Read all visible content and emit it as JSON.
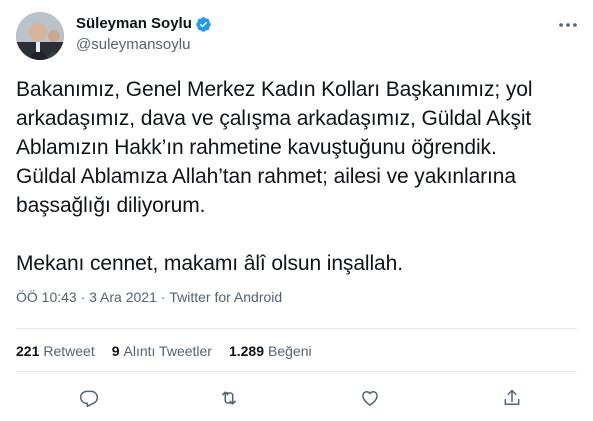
{
  "user": {
    "name": "Süleyman Soylu",
    "handle": "@suleymansoylu"
  },
  "tweet": {
    "text": "Bakanımız, Genel Merkez Kadın Kolları Başkanımız; yol\narkadaşımız, dava ve çalışma arkadaşımız, Güldal Akşit\nAblamızın Hakk’ın rahmetine kavuştuğunu öğrendik.\nGüldal Ablamıza Allah’tan rahmet; ailesi ve yakınlarına\nbaşsağlığı diliyorum.\n\nMekanı cennet, makamı âlî olsun inşallah.",
    "time": "ÖÖ 10:43",
    "date": "3 Ara 2021",
    "source": "Twitter for Android",
    "separator": "·"
  },
  "stats": {
    "retweets": {
      "count": "221",
      "label": "Retweet"
    },
    "quotes": {
      "count": "9",
      "label": "Alıntı Tweetler"
    },
    "likes": {
      "count": "1.289",
      "label": "Beğeni"
    }
  },
  "icons": {
    "verified": "verified-badge-icon",
    "more": "more-options-icon",
    "reply": "reply-icon",
    "retweet": "retweet-icon",
    "like": "like-icon",
    "share": "share-icon"
  },
  "colors": {
    "verified": "#1d9bf0",
    "text": "#0f1419",
    "secondary": "#536471",
    "divider": "#e7eaed"
  }
}
